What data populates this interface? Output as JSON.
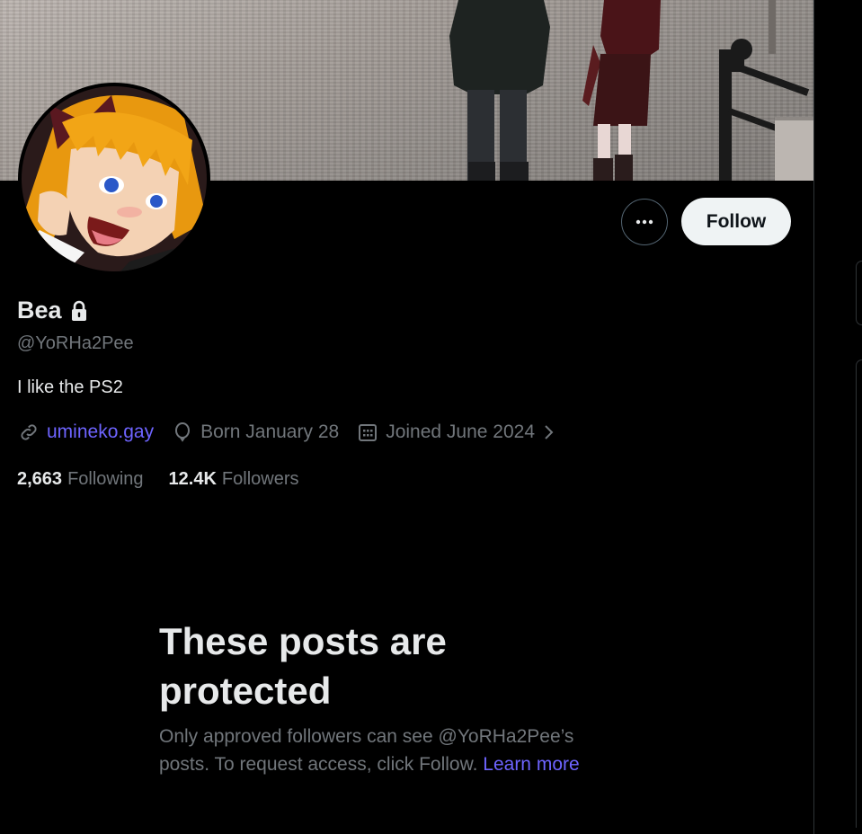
{
  "profile": {
    "name": "Bea",
    "handle": "@YoRHa2Pee",
    "bio": "I like the PS2",
    "website": "umineko.gay",
    "birthday": "Born January 28",
    "joined": "Joined June 2024",
    "following_count": "2,663",
    "following_label": "Following",
    "followers_count": "12.4K",
    "followers_label": "Followers"
  },
  "actions": {
    "follow_label": "Follow"
  },
  "protected_notice": {
    "heading_line1": "These posts are",
    "heading_line2": "protected",
    "body_line1": "Only approved followers can see @YoRHa2Pee’s",
    "body_line2": "posts. To request access, click Follow.",
    "learn_more": "Learn more"
  },
  "icons": {
    "protected": "lock-icon",
    "more": "more-icon",
    "website": "link-icon",
    "birthday": "balloon-icon",
    "joined": "calendar-icon",
    "joined_more": "chevron-right-icon"
  },
  "colors": {
    "background": "#000000",
    "text_primary": "#e7e9ea",
    "text_secondary": "#71767b",
    "link": "#6e64ff",
    "follow_button_bg": "#eff3f4",
    "follow_button_text": "#0f1419"
  }
}
